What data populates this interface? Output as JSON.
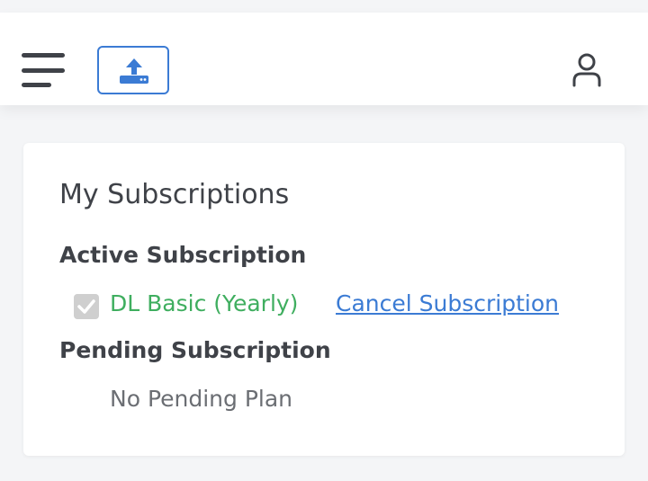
{
  "header": {
    "menu_icon": "hamburger-menu-icon",
    "upload_icon": "upload-icon",
    "user_icon": "user-icon",
    "accent_color": "#3b7bd4"
  },
  "subscriptions": {
    "title": "My Subscriptions",
    "active_label": "Active Subscription",
    "active_plan": "DL Basic (Yearly)",
    "active_checked": true,
    "cancel_label": "Cancel Subscription",
    "pending_label": "Pending Subscription",
    "pending_value": "No Pending Plan",
    "plan_color": "#3fae5f"
  }
}
